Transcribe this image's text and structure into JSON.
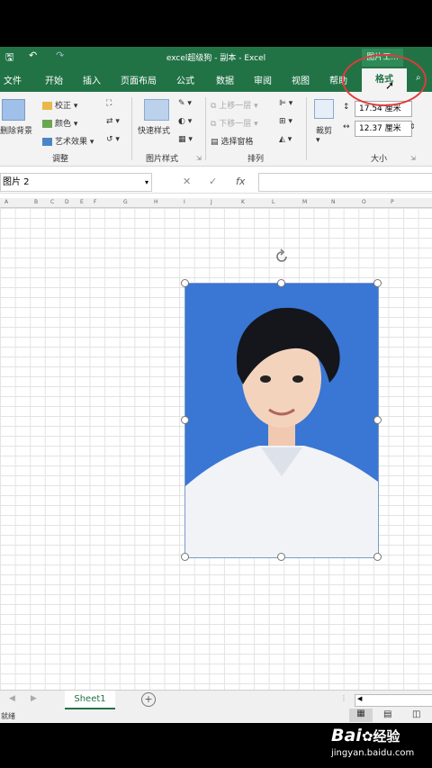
{
  "window": {
    "title": "excel超级狗 - 副本 - Excel",
    "context_tab_header": "图片工..."
  },
  "tabs": [
    "文件",
    "开始",
    "插入",
    "页面布局",
    "公式",
    "数据",
    "审阅",
    "视图",
    "帮助",
    "格式"
  ],
  "ribbon": {
    "remove_bg": "删除背景",
    "corrections": "校正",
    "color": "颜色",
    "artistic": "艺术效果",
    "adjust_group": "调整",
    "quick_styles": "快速样式",
    "picture_styles_group": "图片样式",
    "bring_forward": "上移一层",
    "send_backward": "下移一层",
    "selection_pane": "选择窗格",
    "arrange_group": "排列",
    "crop": "裁剪",
    "height_value": "17.54 厘米",
    "width_value": "12.37 厘米",
    "size_group": "大小"
  },
  "formula_bar": {
    "name_box": "图片 2",
    "cancel": "✕",
    "enter": "✓",
    "fx": "fx"
  },
  "columns": [
    "A",
    "B",
    "C",
    "D",
    "E",
    "F",
    "G",
    "H",
    "I",
    "J",
    "K",
    "L",
    "M",
    "N",
    "O",
    "P"
  ],
  "sheet": {
    "tab": "Sheet1",
    "add": "+"
  },
  "status": {
    "ready": "就绪"
  },
  "watermark": {
    "logo": "Bai",
    "text": "经验",
    "url": "jingyan.baidu.com"
  },
  "colors": {
    "excel_green": "#217346",
    "highlight_circle": "#e03b3b",
    "photo_bg": "#3a76d4"
  }
}
